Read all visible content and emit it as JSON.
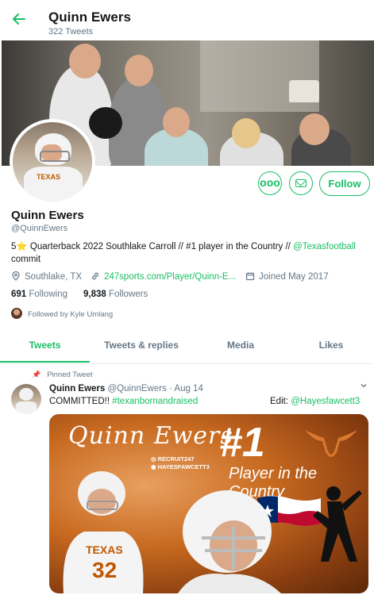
{
  "header": {
    "back_icon": "arrow-left-icon",
    "name": "Quinn Ewers",
    "tweet_count": "322 Tweets"
  },
  "profile": {
    "name": "Quinn Ewers",
    "handle": "@QuinnEwers",
    "bio_prefix": "5",
    "bio_star": "⭐",
    "bio_main": " Quarterback 2022 Southlake Carroll // #1 player in the Country // ",
    "bio_link": "@Texasfootball",
    "bio_suffix": " commit",
    "location": "Southlake, TX",
    "website": "247sports.com/Player/Quinn-E...",
    "joined": "Joined May 2017",
    "following_count": "691",
    "following_label": "Following",
    "followers_count": "9,838",
    "followers_label": "Followers",
    "followed_by": "Followed by Kyle Umlang",
    "follow_label": "Follow",
    "more_label": "ooo"
  },
  "tabs": [
    {
      "label": "Tweets",
      "active": true
    },
    {
      "label": "Tweets & replies",
      "active": false
    },
    {
      "label": "Media",
      "active": false
    },
    {
      "label": "Likes",
      "active": false
    }
  ],
  "tweet": {
    "pinned_label": "Pinned Tweet",
    "name": "Quinn Ewers",
    "handle_date": "@QuinnEwers · Aug 14",
    "text_prefix": "COMMITTED!! ",
    "hashtag": "#texanbornandraised",
    "edit_prefix": "Edit: ",
    "edit_handle": "@Hayesfawcett3",
    "media": {
      "script_name": "Quinn Ewers",
      "rank": "#1",
      "headline": "Player in the Country",
      "social_1": "RECRUIT247",
      "social_2": "HAYESFAWCETT3",
      "jersey_text": "TEXAS",
      "jersey_number": "32"
    }
  },
  "colors": {
    "accent": "#17bf63",
    "secondary_text": "#657786",
    "burnt_orange": "#bf5700"
  }
}
